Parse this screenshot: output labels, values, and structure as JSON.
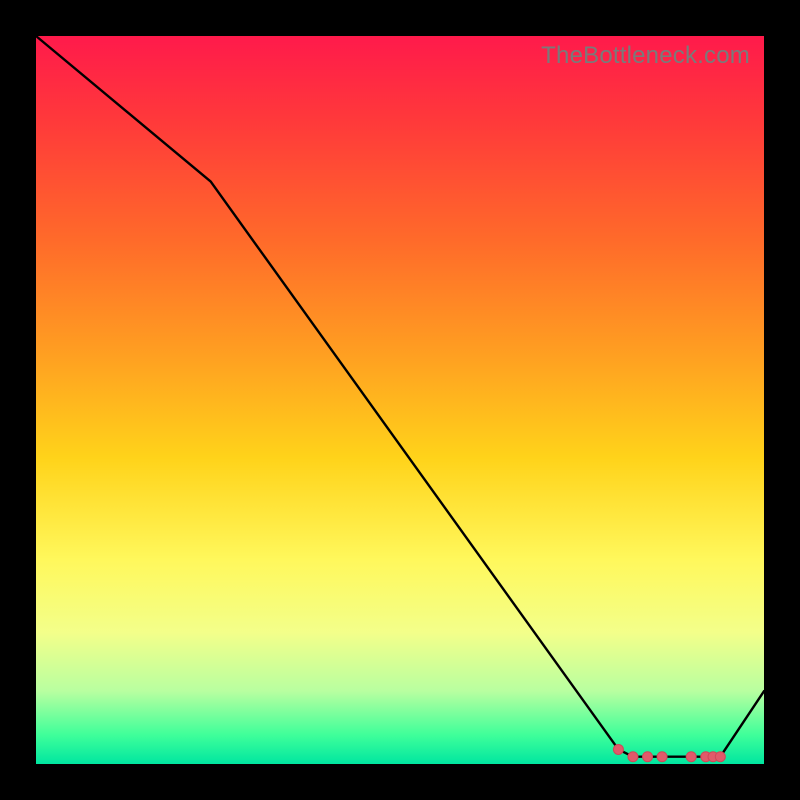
{
  "watermark": "TheBottleneck.com",
  "colors": {
    "line": "#000000",
    "marker_fill": "#e05a6a",
    "marker_stroke": "#d04858"
  },
  "chart_data": {
    "type": "line",
    "title": "",
    "xlabel": "",
    "ylabel": "",
    "xlim": [
      0,
      100
    ],
    "ylim": [
      0,
      100
    ],
    "x": [
      0,
      24,
      80,
      82,
      84,
      86,
      88,
      90,
      92,
      93,
      94,
      100
    ],
    "values": [
      100,
      80,
      2,
      1,
      1,
      1,
      1,
      1,
      1,
      1,
      1,
      10
    ],
    "markers_x": [
      80,
      82,
      84,
      86,
      90,
      92,
      93,
      94
    ],
    "markers_values": [
      2,
      1,
      1,
      1,
      1,
      1,
      1,
      1
    ]
  }
}
